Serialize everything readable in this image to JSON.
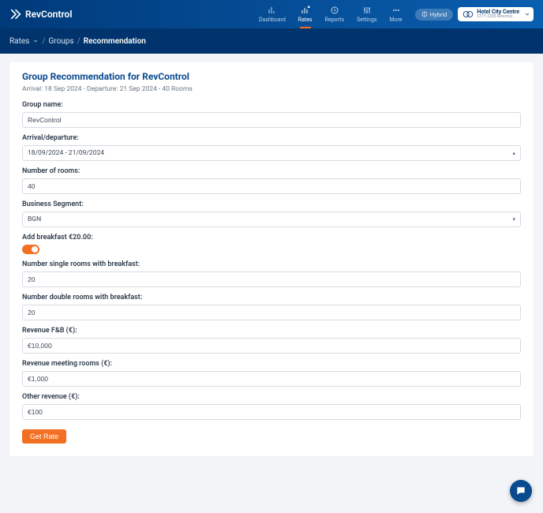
{
  "brand": "RevControl",
  "nav": {
    "dashboard": "Dashboard",
    "rates": "Rates",
    "reports": "Reports",
    "settings": "Settings",
    "more": "More"
  },
  "header": {
    "hybrid": "Hybrid",
    "hotel_name": "Hotel City Centre",
    "hotel_loc": "CITY (205 Rooms)"
  },
  "breadcrumb": {
    "rates": "Rates",
    "groups": "Groups",
    "recommendation": "Recommendation"
  },
  "card": {
    "title": "Group Recommendation for RevControl",
    "subtitle": "Arrival: 18 Sep 2024 - Departure: 21 Sep 2024 - 40 Rooms"
  },
  "fields": {
    "group_name_label": "Group name:",
    "group_name_value": "RevControl",
    "arrival_label": "Arrival/departure:",
    "arrival_value": "18/09/2024 - 21/09/2024",
    "num_rooms_label": "Number of rooms:",
    "num_rooms_value": "40",
    "business_label": "Business Segment:",
    "business_value": "BGN",
    "breakfast_label": "Add breakfast €20.00:",
    "single_label": "Number single rooms with breakfast:",
    "single_value": "20",
    "double_label": "Number double rooms with breakfast:",
    "double_value": "20",
    "fnb_label": "Revenue F&B (€):",
    "fnb_value": "€10,000",
    "meeting_label": "Revenue meeting rooms (€):",
    "meeting_value": "€1,000",
    "other_label": "Other revenue (€):",
    "other_value": "€100"
  },
  "buttons": {
    "get_rate": "Get Rate"
  }
}
